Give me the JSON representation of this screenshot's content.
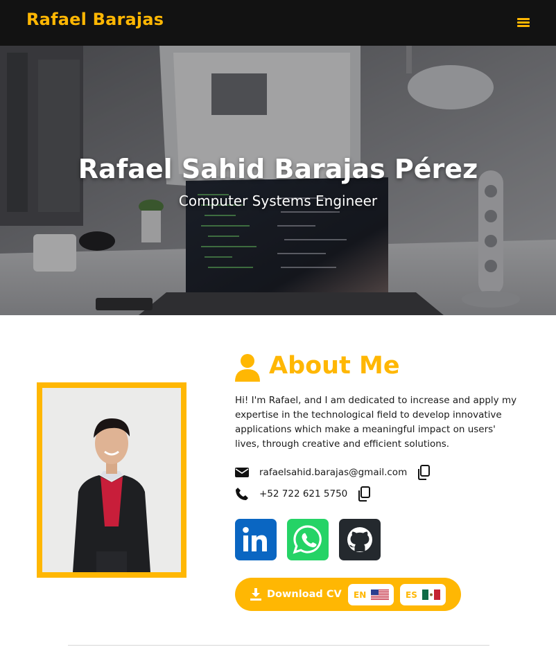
{
  "navbar": {
    "brand": "Rafael Barajas",
    "menu_icon": "hamburger-menu-icon"
  },
  "hero": {
    "title": "Rafael Sahid Barajas Pérez",
    "subtitle": "Computer Systems Engineer"
  },
  "about": {
    "icon": "user-icon",
    "title": "About Me",
    "description": "Hi! I'm Rafael, and I am dedicated to increase and apply my expertise in the technological field to develop innovative applications which make a meaningful impact on users' lives, through creative and efficient solutions.",
    "contacts": {
      "email": {
        "icon": "envelope-icon",
        "value": "rafaelsahid.barajas@gmail.com",
        "copy_icon": "copy-icon"
      },
      "phone": {
        "icon": "phone-icon",
        "value": "+52 722 621 5750",
        "copy_icon": "copy-icon"
      }
    },
    "social": [
      {
        "name": "LinkedIn",
        "icon": "linkedin-icon",
        "color": "#0a66c2"
      },
      {
        "name": "WhatsApp",
        "icon": "whatsapp-icon",
        "color": "#25d366"
      },
      {
        "name": "GitHub",
        "icon": "github-icon",
        "color": "#24292e"
      }
    ],
    "download": {
      "icon": "download-icon",
      "label": "Download CV",
      "languages": [
        {
          "code": "EN",
          "flag": "us-flag-icon"
        },
        {
          "code": "ES",
          "flag": "mexico-flag-icon"
        }
      ]
    }
  },
  "colors": {
    "accent": "#ffb703",
    "navbar_bg": "#121212"
  }
}
